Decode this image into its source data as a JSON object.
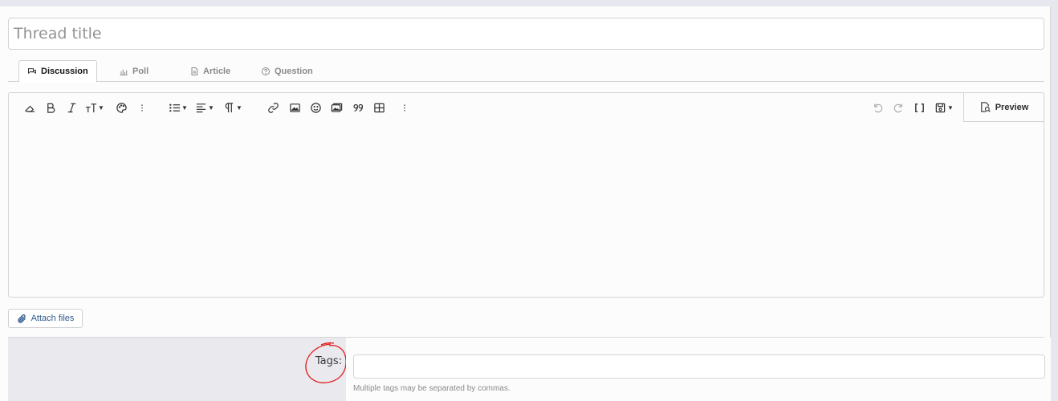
{
  "thread_title": {
    "value": "",
    "placeholder": "Thread title"
  },
  "tabs": [
    {
      "label": "Discussion",
      "icon": "discussion-icon",
      "active": true
    },
    {
      "label": "Poll",
      "icon": "poll-icon",
      "active": false
    },
    {
      "label": "Article",
      "icon": "article-icon",
      "active": false
    },
    {
      "label": "Question",
      "icon": "question-icon",
      "active": false
    }
  ],
  "toolbar": {
    "left_icons": [
      "eraser-icon",
      "bold-icon",
      "italic-icon",
      "font-size-icon",
      "palette-icon",
      "more-text-icon",
      "list-icon",
      "align-icon",
      "paragraph-icon",
      "link-icon",
      "image-icon",
      "smilie-icon",
      "media-icon",
      "quote-icon",
      "table-icon",
      "more-insert-icon"
    ],
    "right_icons": [
      "undo-icon",
      "redo-icon",
      "bbcode-icon",
      "drafts-icon"
    ],
    "preview_label": "Preview"
  },
  "attach": {
    "label": "Attach files"
  },
  "tags": {
    "label": "Tags:",
    "value": "",
    "hint": "Multiple tags may be separated by commas."
  },
  "colors": {
    "accent": "#2f5a8c",
    "annotation": "#e01b1b"
  }
}
